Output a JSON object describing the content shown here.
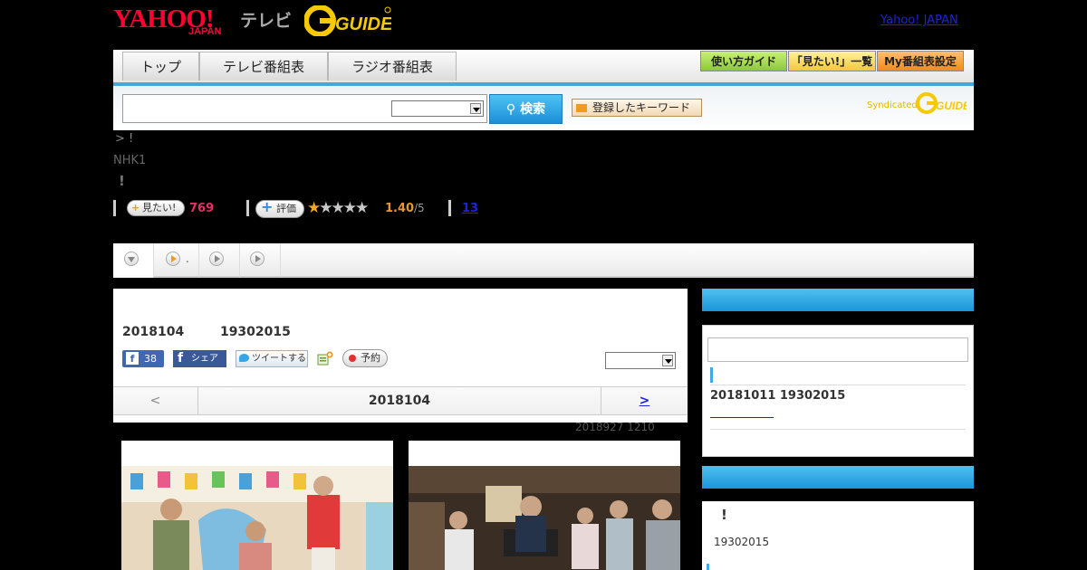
{
  "header": {
    "logo_yahoo": "YAHOO!",
    "logo_japan": "JAPAN",
    "logo_tv": "テレビ",
    "logo_gguide": "G-GUIDE",
    "yahoo_japan_link": "Yahoo! JAPAN"
  },
  "nav": {
    "tabs": [
      "トップ",
      "テレビ番組表",
      "ラジオ番組表"
    ],
    "buttons": [
      "使い方ガイド",
      "「見たい!」一覧",
      "My番組表設定"
    ],
    "button_colors": [
      "#9fd64a",
      "#ffd75a",
      "#f39a26"
    ]
  },
  "search": {
    "button_label": "検索",
    "keyword_button": "登録したキーワード",
    "syndicated": "Syndicated"
  },
  "program": {
    "breadcrumb": "> !",
    "channel": "NHK1",
    "title_mark": "!",
    "mitai_label": "見たい!",
    "mitai_count": "769",
    "hyoka_label": "評価",
    "rating": "1.40",
    "rating_max": "/5",
    "rating_stars": 1,
    "review_count": "13"
  },
  "tabs_row": {
    "item2_label": "."
  },
  "main": {
    "date": "2018104",
    "time": "19302015",
    "fb_count": "38",
    "fb_share": "シェア",
    "tweet": "ツイートする",
    "reserve": "予約",
    "pager_prev": "<",
    "pager_date": "2018104",
    "pager_next": ">",
    "updated": "2018927  1210"
  },
  "sidebar": {
    "box1_date": "20181011  19302015",
    "box2_mark": "!",
    "box2_time": "19302015"
  },
  "colors": {
    "accent_blue": "#3fa9e4",
    "yahoo_red": "#ff0033",
    "mitai_pink": "#e3306b",
    "rating_orange": "#e4973a",
    "link_blue": "#1e23d8"
  }
}
